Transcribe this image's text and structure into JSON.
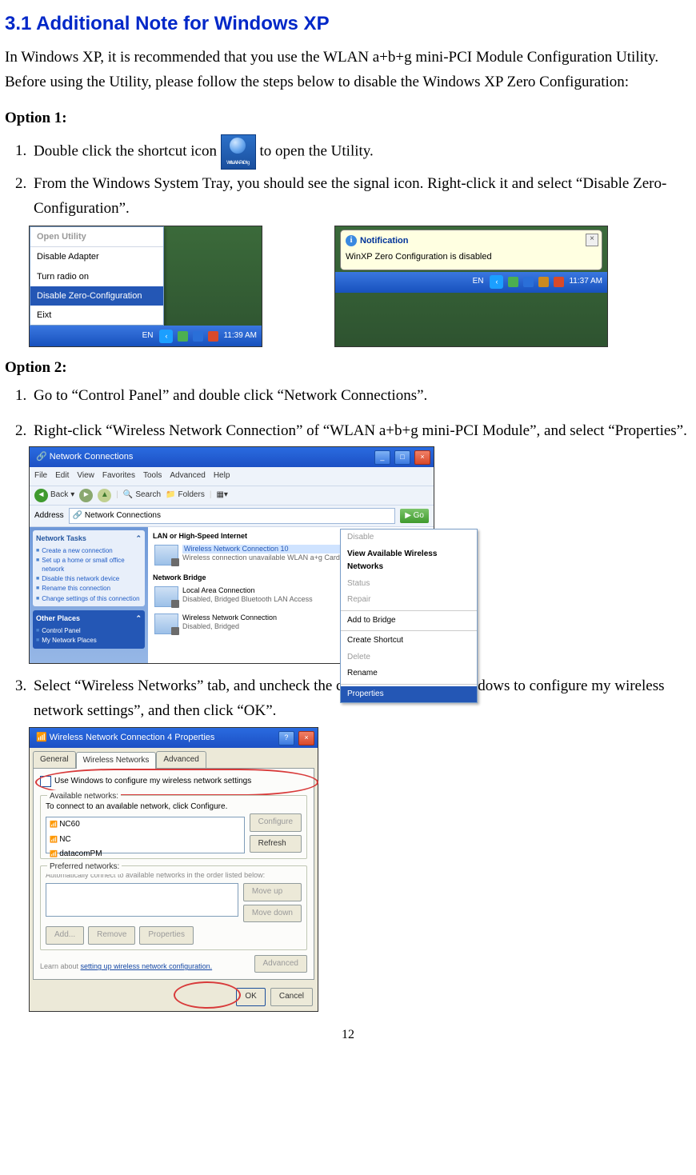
{
  "heading": "3.1 Additional Note for Windows XP",
  "intro": "In Windows XP, it is recommended that you use the WLAN a+b+g mini-PCI Module Configuration Utility.  Before using the Utility, please follow the steps below to disable the Windows XP Zero Configuration:",
  "option1": {
    "label": "Option 1:",
    "steps": {
      "s1a": "Double click the shortcut icon ",
      "s1b": " to open the Utility.",
      "s2": "From the Windows System Tray, you should see the signal icon.  Right-click it and select “Disable Zero-Configuration”."
    },
    "icon_label_top": "WLAN a+g",
    "icon_label_bottom": "mini-PCI",
    "menu": {
      "open": "Open Utility",
      "disable_adapter": "Disable Adapter",
      "turn_radio": "Turn radio on",
      "disable_zero": "Disable Zero-Configuration",
      "exit": "Eixt"
    },
    "taskbar": {
      "lang": "EN",
      "time1": "11:39 AM",
      "time2": "11:37 AM"
    },
    "balloon": {
      "title": "Notification",
      "body": "WinXP Zero Configuration is disabled"
    }
  },
  "option2": {
    "label": "Option 2:",
    "s1": "Go to “Control Panel” and double click “Network Connections”.",
    "s2": "Right-click “Wireless Network Connection” of “WLAN a+b+g  mini-PCI Module”, and select “Properties”.",
    "s3": "Select “Wireless Networks” tab, and uncheck the check box of “Use Windows to configure my wireless network settings”, and then click “OK”."
  },
  "fig3": {
    "title": "Network Connections",
    "menus": [
      "File",
      "Edit",
      "View",
      "Favorites",
      "Tools",
      "Advanced",
      "Help"
    ],
    "toolbar": {
      "back": "Back",
      "search": "Search",
      "folders": "Folders"
    },
    "address_label": "Address",
    "address_value": "Network Connections",
    "go": "Go",
    "side": {
      "tasks_head": "Network Tasks",
      "tasks": [
        "Create a new connection",
        "Set up a home or small office network",
        "Disable this network device",
        "Rename this connection",
        "Change settings of this connection"
      ],
      "other_head": "Other Places",
      "others": [
        "Control Panel",
        "My Network Places"
      ]
    },
    "main": {
      "grp1": "LAN or High-Speed Internet",
      "wnc_name": "Wireless Network Connection 10",
      "wnc_sub": "Wireless connection unavailable\nWLAN a+g Cardbus",
      "grp2": "Network Bridge",
      "lac_name": "Local Area Connection",
      "lac_sub": "Disabled, Bridged\nBluetooth LAN Access",
      "wnc2_name": "Wireless Network Connection",
      "wnc2_sub": "Disabled, Bridged"
    },
    "ctx": {
      "disable": "Disable",
      "view": "View Available Wireless Networks",
      "status": "Status",
      "repair": "Repair",
      "bridge": "Add to Bridge",
      "shortcut": "Create Shortcut",
      "delete": "Delete",
      "rename": "Rename",
      "properties": "Properties"
    }
  },
  "fig4": {
    "title": "Wireless Network Connection 4 Properties",
    "tabs": {
      "general": "General",
      "wireless": "Wireless Networks",
      "advanced": "Advanced"
    },
    "check_label": "Use Windows to configure my wireless network settings",
    "avail_head": "Available networks:",
    "avail_desc": "To connect to an available network, click Configure.",
    "nets": [
      "NC60",
      "NC",
      "datacomPM"
    ],
    "btn_configure": "Configure",
    "btn_refresh": "Refresh",
    "pref_head": "Preferred networks:",
    "pref_desc": "Automatically connect to available networks in the order listed below:",
    "btn_moveup": "Move up",
    "btn_movedown": "Move down",
    "btn_add": "Add...",
    "btn_remove": "Remove",
    "btn_props": "Properties",
    "link_a": "Learn about ",
    "link_u": "setting up wireless network configuration.",
    "btn_adv": "Advanced",
    "btn_ok": "OK",
    "btn_cancel": "Cancel"
  },
  "page_number": "12"
}
